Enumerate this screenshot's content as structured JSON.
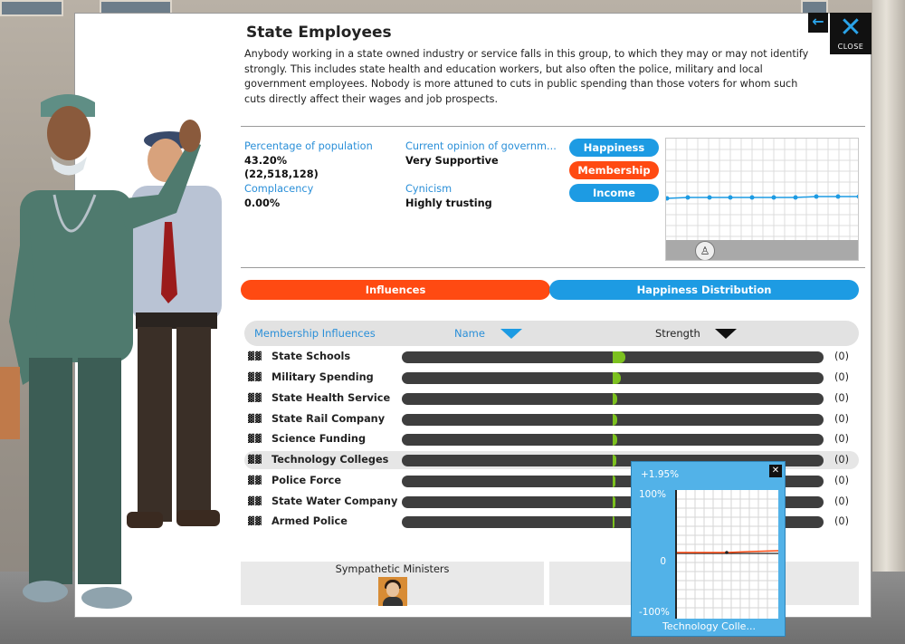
{
  "header": {
    "title": "State Employees",
    "description": "Anybody working in a state owned industry or service falls in this group, to which they may or may not identify strongly. This includes state health and education workers, but also often the police, military and local government employees. Nobody is more attuned to cuts in public spending than those voters for whom such cuts directly affect their wages and job prospects.",
    "close_label": "CLOSE",
    "close_icon": "close-icon",
    "back_icon": "back-arrow-icon"
  },
  "stats": {
    "percentage_label": "Percentage of population",
    "percentage_value": "43.20%",
    "population_value": "(22,518,128)",
    "complacency_label": "Complacency",
    "complacency_value": "0.00%",
    "opinion_label": "Current opinion of governm...",
    "opinion_value": "Very Supportive",
    "cynicism_label": "Cynicism",
    "cynicism_value": "Highly trusting"
  },
  "graph_buttons": {
    "happiness": "Happiness",
    "membership": "Membership",
    "income": "Income"
  },
  "tabs": {
    "influences": "Influences",
    "happiness_distribution": "Happiness Distribution"
  },
  "list_header": {
    "title": "Membership Influences",
    "name_col": "Name",
    "strength_col": "Strength"
  },
  "influences": [
    {
      "name": "State Schools",
      "value": "(0)",
      "strength": 0.03
    },
    {
      "name": "Military Spending",
      "value": "(0)",
      "strength": 0.02
    },
    {
      "name": "State Health Service",
      "value": "(0)",
      "strength": 0.01
    },
    {
      "name": "State Rail Company",
      "value": "(0)",
      "strength": 0.01
    },
    {
      "name": "Science Funding",
      "value": "(0)",
      "strength": 0.01
    },
    {
      "name": "Technology Colleges",
      "value": "(0)",
      "strength": 0.008
    },
    {
      "name": "Police Force",
      "value": "(0)",
      "strength": 0.007
    },
    {
      "name": "State Water Company",
      "value": "(0)",
      "strength": 0.006
    },
    {
      "name": "Armed Police",
      "value": "(0)",
      "strength": 0.005
    }
  ],
  "ministers": {
    "label": "Sympathetic Ministers"
  },
  "popup": {
    "value_label": "+1.95%",
    "y_top": "100%",
    "y_mid": "0",
    "y_bottom": "-100%",
    "name": "Technology Colle...",
    "close_icon": "close-icon"
  },
  "colors": {
    "accent_blue": "#1d9be3",
    "accent_orange": "#ff4a12",
    "bar_green": "#7cc11f"
  }
}
